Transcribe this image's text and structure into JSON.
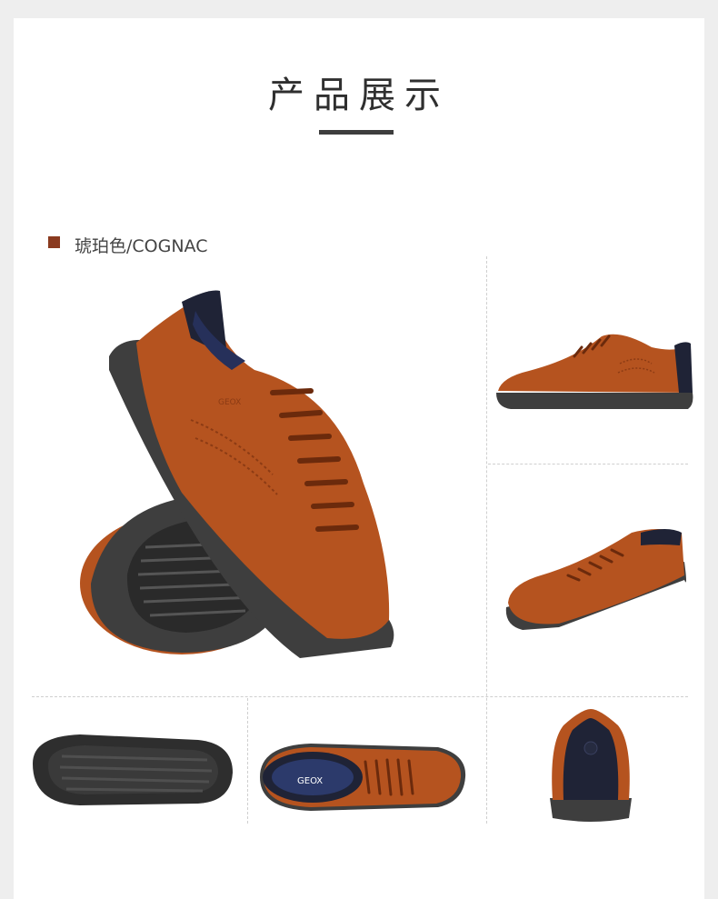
{
  "page": {
    "title": "产品展示"
  },
  "color_variant": {
    "label": "琥珀色/COGNAC",
    "swatch_color": "#8a3a1f"
  },
  "brand": {
    "logo_text": "GEOX"
  },
  "colors": {
    "leather": "#b5531f",
    "leather_dark": "#8c3b14",
    "sole": "#4a4a4a",
    "navy": "#1f2336"
  },
  "views": [
    {
      "name": "hero-pair-view"
    },
    {
      "name": "side-view-right"
    },
    {
      "name": "three-quarter-view"
    },
    {
      "name": "outsole-view"
    },
    {
      "name": "top-view"
    },
    {
      "name": "rear-view"
    }
  ]
}
